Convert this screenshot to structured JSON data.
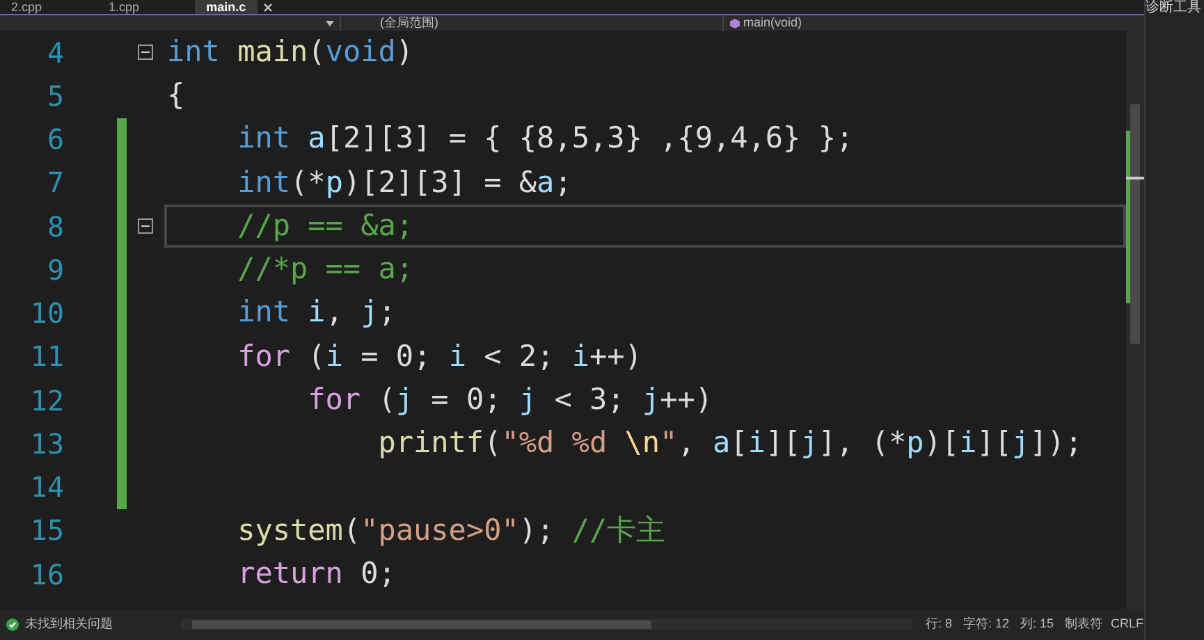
{
  "tabs": [
    {
      "label": "2.cpp",
      "selected": false
    },
    {
      "label": "1.cpp",
      "selected": false
    },
    {
      "label": "main.c",
      "selected": true
    }
  ],
  "nav_bar": {
    "scope": "(全局范围)",
    "member": "main(void)"
  },
  "editor": {
    "lines": [
      {
        "number": "4",
        "changed": false,
        "fold": true,
        "current": false,
        "tokens": [
          {
            "kind": "kw",
            "text": "int"
          },
          {
            "kind": "fn",
            "text": " main"
          },
          {
            "kind": "p",
            "text": "("
          },
          {
            "kind": "kw",
            "text": "void"
          },
          {
            "kind": "p",
            "text": ")"
          }
        ]
      },
      {
        "number": "5",
        "changed": false,
        "fold": false,
        "current": false,
        "tokens": [
          {
            "kind": "p",
            "text": "{"
          }
        ]
      },
      {
        "number": "6",
        "changed": true,
        "fold": false,
        "current": false,
        "tokens": [
          {
            "kind": "kw",
            "text": "    int"
          },
          {
            "kind": "var",
            "text": " a"
          },
          {
            "kind": "p",
            "text": "[2][3] = { {8,5,3} ,{9,4,6} };"
          }
        ]
      },
      {
        "number": "7",
        "changed": true,
        "fold": false,
        "current": false,
        "tokens": [
          {
            "kind": "kw",
            "text": "    int"
          },
          {
            "kind": "p",
            "text": "(*"
          },
          {
            "kind": "var",
            "text": "p"
          },
          {
            "kind": "p",
            "text": ")[2][3] = &"
          },
          {
            "kind": "var",
            "text": "a"
          },
          {
            "kind": "p",
            "text": ";"
          }
        ]
      },
      {
        "number": "8",
        "changed": true,
        "fold": true,
        "current": true,
        "tokens": [
          {
            "kind": "cm",
            "text": "    //p == &a;"
          }
        ]
      },
      {
        "number": "9",
        "changed": true,
        "fold": false,
        "current": false,
        "tokens": [
          {
            "kind": "cm",
            "text": "    //*p == a;"
          }
        ]
      },
      {
        "number": "10",
        "changed": true,
        "fold": false,
        "current": false,
        "tokens": [
          {
            "kind": "kw",
            "text": "    int"
          },
          {
            "kind": "var",
            "text": " i"
          },
          {
            "kind": "p",
            "text": ", "
          },
          {
            "kind": "var",
            "text": "j"
          },
          {
            "kind": "p",
            "text": ";"
          }
        ]
      },
      {
        "number": "11",
        "changed": true,
        "fold": false,
        "current": false,
        "tokens": [
          {
            "kind": "ctl",
            "text": "    for"
          },
          {
            "kind": "p",
            "text": " ("
          },
          {
            "kind": "var",
            "text": "i"
          },
          {
            "kind": "p",
            "text": " = 0; "
          },
          {
            "kind": "var",
            "text": "i"
          },
          {
            "kind": "p",
            "text": " < 2; "
          },
          {
            "kind": "var",
            "text": "i"
          },
          {
            "kind": "p",
            "text": "++)"
          }
        ]
      },
      {
        "number": "12",
        "changed": true,
        "fold": false,
        "current": false,
        "tokens": [
          {
            "kind": "ctl",
            "text": "        for"
          },
          {
            "kind": "p",
            "text": " ("
          },
          {
            "kind": "var",
            "text": "j"
          },
          {
            "kind": "p",
            "text": " = 0; "
          },
          {
            "kind": "var",
            "text": "j"
          },
          {
            "kind": "p",
            "text": " < 3; "
          },
          {
            "kind": "var",
            "text": "j"
          },
          {
            "kind": "p",
            "text": "++)"
          }
        ]
      },
      {
        "number": "13",
        "changed": true,
        "fold": false,
        "current": false,
        "tokens": [
          {
            "kind": "fn",
            "text": "            printf"
          },
          {
            "kind": "p",
            "text": "("
          },
          {
            "kind": "str",
            "text": "\"%d %d "
          },
          {
            "kind": "esc",
            "text": "\\n"
          },
          {
            "kind": "str",
            "text": "\""
          },
          {
            "kind": "p",
            "text": ", "
          },
          {
            "kind": "var",
            "text": "a"
          },
          {
            "kind": "p",
            "text": "["
          },
          {
            "kind": "var",
            "text": "i"
          },
          {
            "kind": "p",
            "text": "]["
          },
          {
            "kind": "var",
            "text": "j"
          },
          {
            "kind": "p",
            "text": "], (*"
          },
          {
            "kind": "var",
            "text": "p"
          },
          {
            "kind": "p",
            "text": ")["
          },
          {
            "kind": "var",
            "text": "i"
          },
          {
            "kind": "p",
            "text": "]["
          },
          {
            "kind": "var",
            "text": "j"
          },
          {
            "kind": "p",
            "text": "]);"
          }
        ]
      },
      {
        "number": "14",
        "changed": true,
        "fold": false,
        "current": false
      },
      {
        "number": "15",
        "changed": false,
        "fold": false,
        "current": false,
        "tokens": [
          {
            "kind": "fn",
            "text": "    system"
          },
          {
            "kind": "p",
            "text": "("
          },
          {
            "kind": "str",
            "text": "\"pause>0\""
          },
          {
            "kind": "p",
            "text": "); "
          },
          {
            "kind": "cm",
            "text": "//卡主"
          }
        ]
      },
      {
        "number": "16",
        "changed": false,
        "fold": false,
        "current": false,
        "tokens": [
          {
            "kind": "ctl",
            "text": "    return"
          },
          {
            "kind": "p",
            "text": " 0;"
          }
        ]
      }
    ]
  },
  "status_bar": {
    "issues": "未找到相关问题",
    "line": "行: 8",
    "char": "字符: 12",
    "col": "列: 15",
    "tabs": "制表符",
    "eol": "CRLF"
  },
  "side_panel": {
    "title": "诊断工具"
  }
}
